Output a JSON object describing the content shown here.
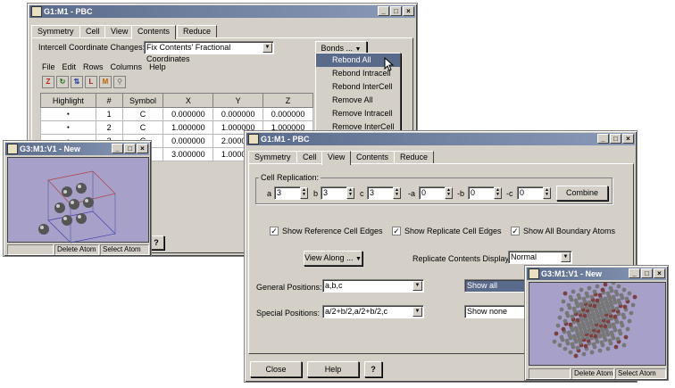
{
  "win1": {
    "title": "G1:M1 - PBC",
    "tabs": [
      "Symmetry",
      "Cell",
      "View",
      "Contents",
      "Reduce"
    ],
    "intercell_label": "Intercell Coordinate Changes:",
    "intercell_value": "Fix Contents' Fractional Coordinates",
    "bonds_button": "Bonds ...",
    "menu": [
      "File",
      "Edit",
      "Rows",
      "Columns",
      "Help"
    ],
    "columns": [
      "Highlight",
      "#",
      "Symbol",
      "X",
      "Y",
      "Z"
    ],
    "rows": [
      {
        "num": "1",
        "symbol": "C",
        "x": "0.000000",
        "y": "0.000000",
        "z": "0.000000"
      },
      {
        "num": "2",
        "symbol": "C",
        "x": "1.000000",
        "y": "1.000000",
        "z": "1.000000"
      },
      {
        "num": "3",
        "symbol": "C",
        "x": "0.000000",
        "y": "2.000000",
        "z": ""
      },
      {
        "num": "",
        "symbol": "",
        "x": "3.000000",
        "y": "1.000000",
        "z": ""
      }
    ]
  },
  "bonds_menu": [
    "Rebond All",
    "Rebond Intracell",
    "Rebond InterCell",
    "Remove All",
    "Remove Intracell",
    "Remove InterCell"
  ],
  "win3a": {
    "title": "G3:M1:V1 - New",
    "status": [
      "",
      "Delete Atom",
      "Select Atom"
    ]
  },
  "win2": {
    "title": "G1:M1 - PBC",
    "tabs": [
      "Symmetry",
      "Cell",
      "View",
      "Contents",
      "Reduce"
    ],
    "cell_replication_label": "Cell Replication:",
    "replication": [
      {
        "label": "a",
        "value": "3"
      },
      {
        "label": "b",
        "value": "3"
      },
      {
        "label": "c",
        "value": "3"
      },
      {
        "label": "-a",
        "value": "0"
      },
      {
        "label": "-b",
        "value": "0"
      },
      {
        "label": "-c",
        "value": "0"
      }
    ],
    "combine_button": "Combine",
    "checkboxes": [
      "Show Reference Cell Edges",
      "Show Replicate Cell Edges",
      "Show All Boundary Atoms"
    ],
    "view_along_button": "View Along ...",
    "replicate_display_label": "Replicate Contents Display:",
    "replicate_display_value": "Normal",
    "general_positions_label": "General Positions:",
    "general_positions_value": "a,b,c",
    "general_show_value": "Show all",
    "special_positions_label": "Special Positions:",
    "special_positions_value": "a/2+b/2,a/2+b/2,c",
    "special_show_value": "Show none",
    "close_button": "Close",
    "help_button": "Help"
  },
  "win3b": {
    "title": "G3:M1:V1 - New",
    "status": [
      "",
      "Delete Atom",
      "Select Atom"
    ]
  },
  "colors": {
    "titlebar": "#5a6a8a",
    "viewport": "#a7a0c8",
    "face": "#d4d0c8"
  }
}
